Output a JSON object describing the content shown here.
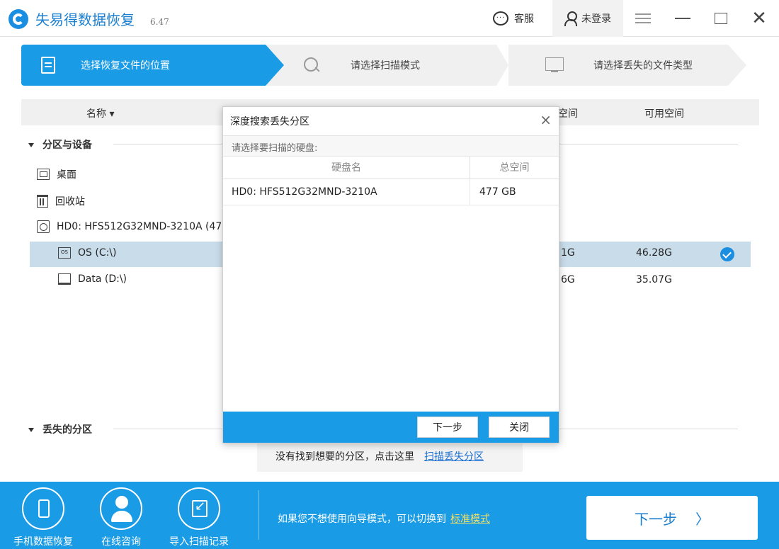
{
  "app": {
    "name": "失易得数据恢复",
    "version": "6.47"
  },
  "titlebar": {
    "service_label": "客服",
    "login_label": "未登录"
  },
  "steps": [
    {
      "label": "选择恢复文件的位置",
      "active": true
    },
    {
      "label": "请选择扫描模式",
      "active": false
    },
    {
      "label": "请选择丢失的文件类型",
      "active": false
    }
  ],
  "columns": {
    "name": "名称",
    "total": "空间",
    "free": "可用空间"
  },
  "tree": {
    "section_devices": "分区与设备",
    "items": {
      "desktop": "桌面",
      "recycle": "回收站",
      "disk": "HD0: HFS512G32MND-3210A (47",
      "os": "OS (C:\\)",
      "data": "Data (D:\\)"
    },
    "os_total": "1G",
    "os_free": "46.28G",
    "data_total": "6G",
    "data_free": "35.07G",
    "section_lost": "丢失的分区"
  },
  "lost_note": {
    "text": "没有找到想要的分区，点击这里",
    "link": "扫描丢失分区"
  },
  "dialog": {
    "title": "深度搜索丢失分区",
    "subtitle": "请选择要扫描的硬盘:",
    "col_disk": "硬盘名",
    "col_space": "总空间",
    "rows": [
      {
        "disk": "HD0: HFS512G32MND-3210A",
        "space": "477 GB"
      }
    ],
    "next_label": "下一步",
    "close_label": "关闭"
  },
  "bottom": {
    "phone_label": "手机数据恢复",
    "consult_label": "在线咨询",
    "import_label": "导入扫描记录",
    "hint_text": "如果您不想使用向导模式，可以切换到",
    "hint_link": "标准模式",
    "next_label": "下一步"
  },
  "colors": {
    "accent": "#1a9be6",
    "selected_row": "#c9dcea",
    "link_yellow": "#f3e066"
  }
}
